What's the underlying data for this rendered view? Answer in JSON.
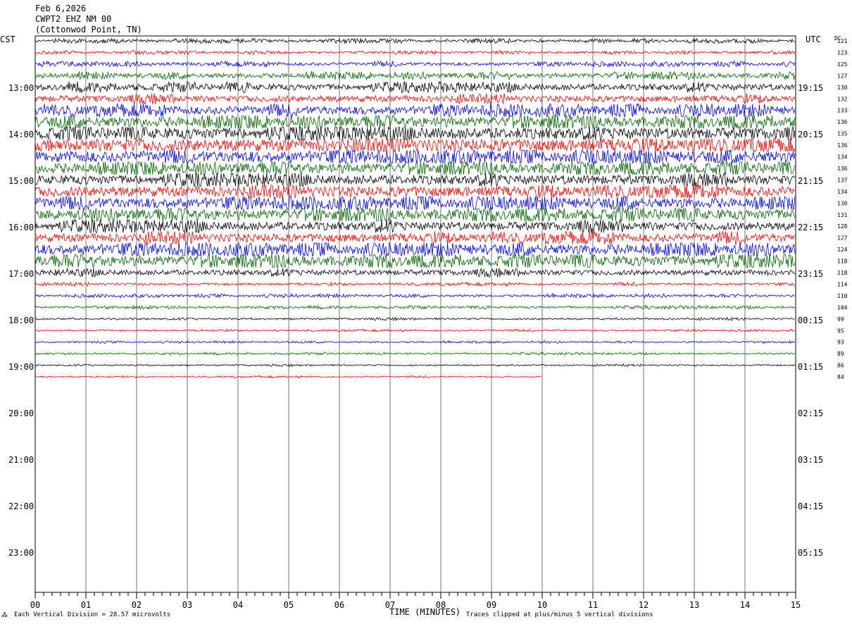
{
  "header": {
    "date": "Feb 6,2026",
    "station": "CWPT2 EHZ NM 00",
    "location": "(Cottonwod Point, TN)"
  },
  "left_zone_label": "CST",
  "right_zone_label": "UTC",
  "dc_label": "DC",
  "left_times": [
    "13:00",
    "14:00",
    "15:00",
    "16:00",
    "17:00",
    "18:00",
    "19:00",
    "20:00",
    "21:00",
    "22:00",
    "23:00"
  ],
  "right_times": [
    "19:15",
    "20:15",
    "21:15",
    "22:15",
    "23:15",
    "00:15",
    "01:15",
    "02:15",
    "03:15",
    "04:15",
    "05:15"
  ],
  "x_ticks": [
    "00",
    "01",
    "02",
    "03",
    "04",
    "05",
    "06",
    "07",
    "08",
    "09",
    "10",
    "11",
    "12",
    "13",
    "14",
    "15"
  ],
  "xlabel": "TIME (MINUTES)",
  "footer_left": "Each Vertical Division =   28.57 microvolts",
  "footer_right": "Traces clipped at plus/minus 5 vertical divisions",
  "chart_data": {
    "type": "line",
    "title": "",
    "xlabel": "TIME (MINUTES)",
    "ylabel": "",
    "xlim": [
      0,
      15
    ],
    "trace_colors": [
      "#000000",
      "#ff0000",
      "#0000ff",
      "#006400"
    ],
    "dc_offsets": [
      121,
      123,
      125,
      127,
      130,
      132,
      133,
      136,
      135,
      136,
      134,
      136,
      137,
      134,
      130,
      131,
      128,
      127,
      124,
      118,
      118,
      114,
      110,
      104,
      99,
      95,
      93,
      89,
      86,
      84
    ],
    "activity": [
      0.25,
      0.2,
      0.3,
      0.45,
      0.6,
      0.6,
      0.8,
      1.0,
      1.1,
      1.2,
      1.1,
      1.0,
      0.9,
      1.0,
      1.0,
      1.0,
      0.8,
      0.8,
      1.0,
      1.0,
      0.5,
      0.2,
      0.2,
      0.18,
      0.15,
      0.12,
      0.12,
      0.12,
      0.12,
      0.1
    ],
    "last_trace_end_minute": 10,
    "grid": true
  }
}
